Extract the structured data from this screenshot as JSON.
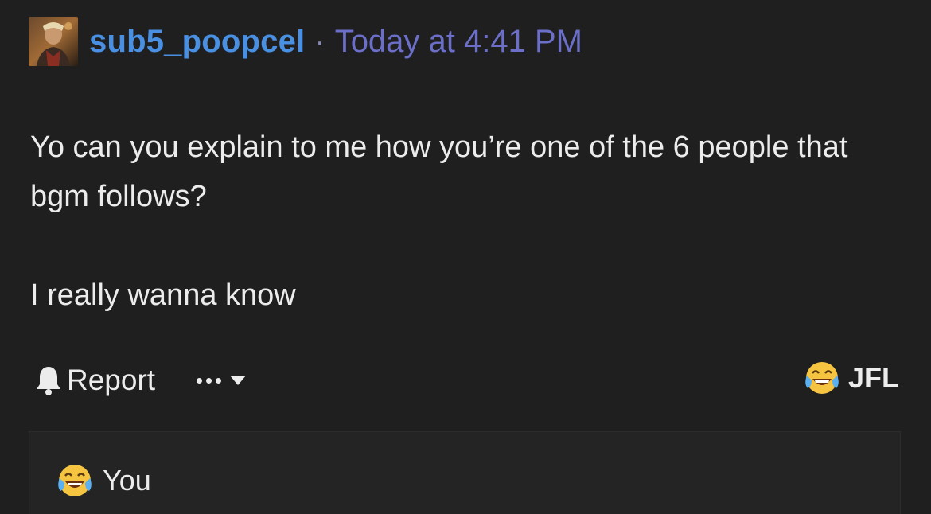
{
  "post": {
    "author": {
      "username": "sub5_poopcel",
      "avatar_icon": "user-avatar"
    },
    "separator": "·",
    "timestamp": "Today at 4:41 PM",
    "message": {
      "paragraph_1": "Yo can you explain to me how you’re one of the 6 people that bgm follows?",
      "paragraph_2": "I really wanna know"
    },
    "actions": {
      "report_label": "Report",
      "report_icon": "bell-icon",
      "more_icon": "ellipsis-icon",
      "dropdown_icon": "caret-down-icon"
    },
    "reaction": {
      "emoji_icon": "face-with-tears-of-joy-icon",
      "label": "JFL"
    },
    "reactors": [
      {
        "emoji_icon": "face-with-tears-of-joy-icon",
        "name": "You"
      }
    ]
  },
  "colors": {
    "background": "#1f1f20",
    "username": "#4a90e2",
    "timestamp": "#6b6fc7",
    "text": "#ececec"
  }
}
